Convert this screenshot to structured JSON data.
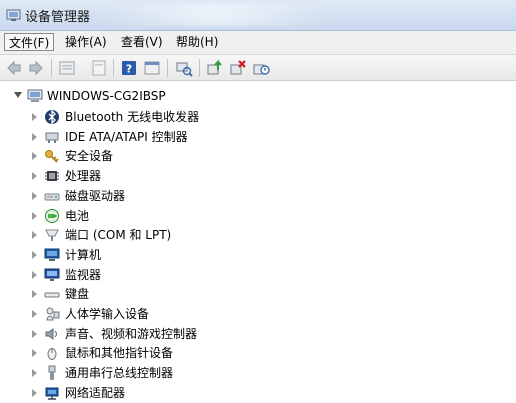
{
  "window": {
    "title": "设备管理器"
  },
  "menu": {
    "items": [
      {
        "label": "文件(F)"
      },
      {
        "label": "操作(A)"
      },
      {
        "label": "查看(V)"
      },
      {
        "label": "帮助(H)"
      }
    ]
  },
  "toolbar": {
    "buttons": [
      "back-icon",
      "forward-icon",
      "properties-icon",
      "update-driver-icon",
      "help-icon",
      "view-icon",
      "scan-hardware-icon",
      "update-icon",
      "uninstall-icon",
      "disable-icon"
    ]
  },
  "tree": {
    "root": {
      "label": "WINDOWS-CG2IBSP"
    },
    "devices": [
      {
        "label": "Bluetooth 无线电收发器",
        "icon": "bluetooth-icon"
      },
      {
        "label": "IDE ATA/ATAPI 控制器",
        "icon": "ide-controller-icon"
      },
      {
        "label": "安全设备",
        "icon": "key-icon"
      },
      {
        "label": "处理器",
        "icon": "processor-icon"
      },
      {
        "label": "磁盘驱动器",
        "icon": "disk-drive-icon"
      },
      {
        "label": "电池",
        "icon": "battery-icon"
      },
      {
        "label": "端口 (COM 和 LPT)",
        "icon": "port-icon"
      },
      {
        "label": "计算机",
        "icon": "computer-icon"
      },
      {
        "label": "监视器",
        "icon": "monitor-icon"
      },
      {
        "label": "键盘",
        "icon": "keyboard-icon"
      },
      {
        "label": "人体学输入设备",
        "icon": "hid-icon"
      },
      {
        "label": "声音、视频和游戏控制器",
        "icon": "sound-icon"
      },
      {
        "label": "鼠标和其他指针设备",
        "icon": "mouse-icon"
      },
      {
        "label": "通用串行总线控制器",
        "icon": "usb-icon"
      },
      {
        "label": "网络适配器",
        "icon": "network-adapter-icon"
      }
    ]
  },
  "colors": {
    "titlebar": "#c9d9ee",
    "menubar": "#f0f0f0",
    "help_blue": "#2a5aa8"
  }
}
